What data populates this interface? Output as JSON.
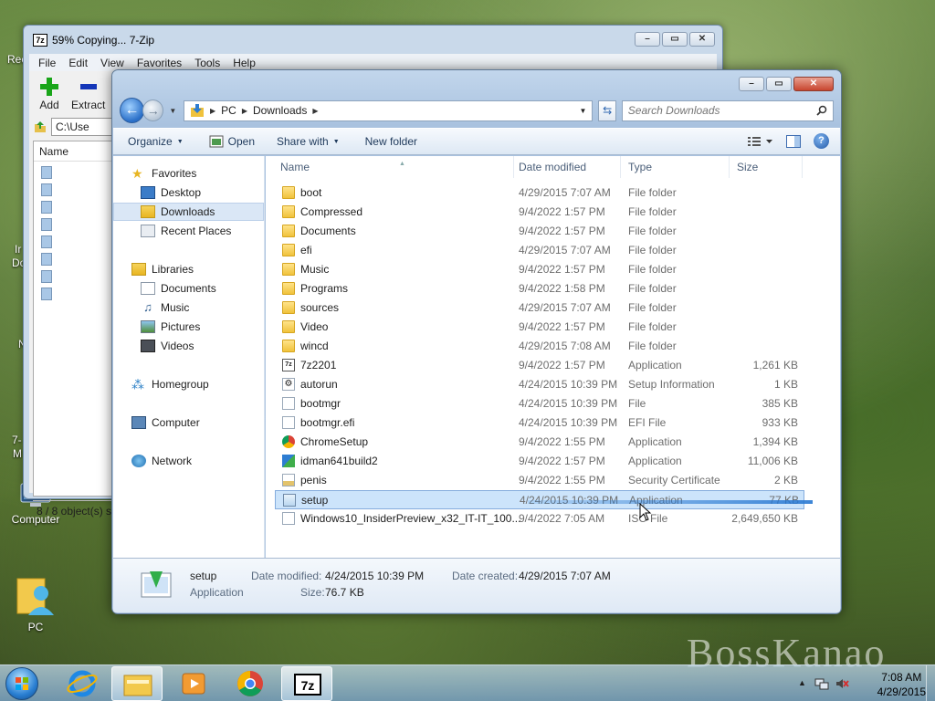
{
  "desktop": {
    "icons": [
      {
        "label": "Computer"
      },
      {
        "label": "PC"
      }
    ],
    "edge_labels": [
      "Rec",
      "Ir",
      "Do",
      "N",
      "7-",
      "M"
    ],
    "watermark": "BossKanao"
  },
  "zip_window": {
    "title": "59% Copying... 7-Zip",
    "menu": [
      "File",
      "Edit",
      "View",
      "Favorites",
      "Tools",
      "Help"
    ],
    "toolbar": {
      "add": "Add",
      "extract": "Extract"
    },
    "address": "C:\\Use",
    "column": "Name",
    "status": "8 / 8 object(s) se"
  },
  "explorer": {
    "breadcrumb": [
      "PC",
      "Downloads"
    ],
    "search_placeholder": "Search Downloads",
    "commands": [
      "Organize",
      "Open",
      "Share with",
      "New folder"
    ],
    "nav": {
      "favorites": "Favorites",
      "favorites_items": [
        "Desktop",
        "Downloads",
        "Recent Places"
      ],
      "libraries": "Libraries",
      "libraries_items": [
        "Documents",
        "Music",
        "Pictures",
        "Videos"
      ],
      "homegroup": "Homegroup",
      "computer": "Computer",
      "network": "Network"
    },
    "columns": {
      "name": "Name",
      "date": "Date modified",
      "type": "Type",
      "size": "Size"
    },
    "files": [
      {
        "name": "boot",
        "date": "4/29/2015 7:07 AM",
        "type": "File folder",
        "size": "",
        "icon": "folder"
      },
      {
        "name": "Compressed",
        "date": "9/4/2022 1:57 PM",
        "type": "File folder",
        "size": "",
        "icon": "folder"
      },
      {
        "name": "Documents",
        "date": "9/4/2022 1:57 PM",
        "type": "File folder",
        "size": "",
        "icon": "folder"
      },
      {
        "name": "efi",
        "date": "4/29/2015 7:07 AM",
        "type": "File folder",
        "size": "",
        "icon": "folder"
      },
      {
        "name": "Music",
        "date": "9/4/2022 1:57 PM",
        "type": "File folder",
        "size": "",
        "icon": "folder"
      },
      {
        "name": "Programs",
        "date": "9/4/2022 1:58 PM",
        "type": "File folder",
        "size": "",
        "icon": "folder"
      },
      {
        "name": "sources",
        "date": "4/29/2015 7:07 AM",
        "type": "File folder",
        "size": "",
        "icon": "folder"
      },
      {
        "name": "Video",
        "date": "9/4/2022 1:57 PM",
        "type": "File folder",
        "size": "",
        "icon": "folder"
      },
      {
        "name": "wincd",
        "date": "4/29/2015 7:08 AM",
        "type": "File folder",
        "size": "",
        "icon": "folder"
      },
      {
        "name": "7z2201",
        "date": "9/4/2022 1:57 PM",
        "type": "Application",
        "size": "1,261 KB",
        "icon": "7z"
      },
      {
        "name": "autorun",
        "date": "4/24/2015 10:39 PM",
        "type": "Setup Information",
        "size": "1 KB",
        "icon": "gear"
      },
      {
        "name": "bootmgr",
        "date": "4/24/2015 10:39 PM",
        "type": "File",
        "size": "385 KB",
        "icon": "file"
      },
      {
        "name": "bootmgr.efi",
        "date": "4/24/2015 10:39 PM",
        "type": "EFI File",
        "size": "933 KB",
        "icon": "file"
      },
      {
        "name": "ChromeSetup",
        "date": "9/4/2022 1:55 PM",
        "type": "Application",
        "size": "1,394 KB",
        "icon": "chrome"
      },
      {
        "name": "idman641build2",
        "date": "9/4/2022 1:57 PM",
        "type": "Application",
        "size": "11,006 KB",
        "icon": "idm"
      },
      {
        "name": "penis",
        "date": "9/4/2022 1:55 PM",
        "type": "Security Certificate",
        "size": "2 KB",
        "icon": "cert"
      },
      {
        "name": "setup",
        "date": "4/24/2015 10:39 PM",
        "type": "Application",
        "size": "77 KB",
        "icon": "setup"
      },
      {
        "name": "Windows10_InsiderPreview_x32_IT-IT_100...",
        "date": "9/4/2022 7:05 AM",
        "type": "ISO File",
        "size": "2,649,650 KB",
        "icon": "iso"
      }
    ],
    "selected_index": 16,
    "details": {
      "name": "setup",
      "kind": "Application",
      "modified_label": "Date modified:",
      "modified": "4/24/2015 10:39 PM",
      "created_label": "Date created:",
      "created": "4/29/2015 7:07 AM",
      "size_label": "Size:",
      "size": "76.7 KB"
    }
  },
  "taskbar": {
    "time": "7:08 AM",
    "date": "4/29/2015"
  },
  "colors": {
    "selection": "#cce4fb",
    "accent": "#2a6fc8",
    "folder": "#f0c23b"
  }
}
